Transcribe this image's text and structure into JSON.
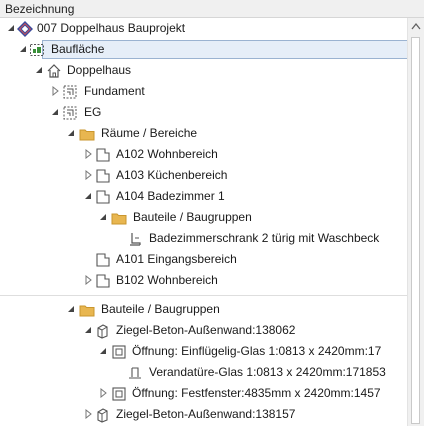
{
  "header": {
    "column_label": "Bezeichnung"
  },
  "tree": [
    {
      "label": "007 Doppelhaus Bauprojekt",
      "icon": "project-icon",
      "expanded": true
    },
    {
      "label": "Baufläche",
      "icon": "site-icon",
      "expanded": true,
      "selected": true
    },
    {
      "label": "Doppelhaus",
      "icon": "house-icon",
      "expanded": true
    },
    {
      "label": "Fundament",
      "icon": "storey-icon",
      "expanded": false
    },
    {
      "label": "EG",
      "icon": "storey-icon",
      "expanded": true
    },
    {
      "label": "Räume / Bereiche",
      "icon": "folder-icon",
      "expanded": true
    },
    {
      "label": "A102 Wohnbereich",
      "icon": "room-icon",
      "expanded": false
    },
    {
      "label": "A103 Küchenbereich",
      "icon": "room-icon",
      "expanded": false
    },
    {
      "label": "A104 Badezimmer 1",
      "icon": "room-icon",
      "expanded": true
    },
    {
      "label": "Bauteile / Baugruppen",
      "icon": "folder-icon",
      "expanded": true
    },
    {
      "label": "Badezimmerschrank 2 türig mit Waschbeck",
      "icon": "furniture-icon"
    },
    {
      "label": "A101 Eingangsbereich",
      "icon": "room-icon"
    },
    {
      "label": "B102 Wohnbereich",
      "icon": "room-icon",
      "expanded": false
    },
    {
      "label": "Bauteile / Baugruppen",
      "icon": "folder-icon",
      "expanded": true
    },
    {
      "label": "Ziegel-Beton-Außenwand:138062",
      "icon": "wall-icon",
      "expanded": true
    },
    {
      "label": "Öffnung: Einflügelig-Glas 1:0813 x 2420mm:17",
      "icon": "opening-icon",
      "expanded": true
    },
    {
      "label": "Verandatüre-Glas 1:0813 x 2420mm:171853",
      "icon": "door-icon"
    },
    {
      "label": "Öffnung: Festfenster:4835mm x 2420mm:1457",
      "icon": "opening-icon",
      "expanded": false
    },
    {
      "label": "Ziegel-Beton-Außenwand:138157",
      "icon": "wall-icon",
      "expanded": false
    }
  ]
}
